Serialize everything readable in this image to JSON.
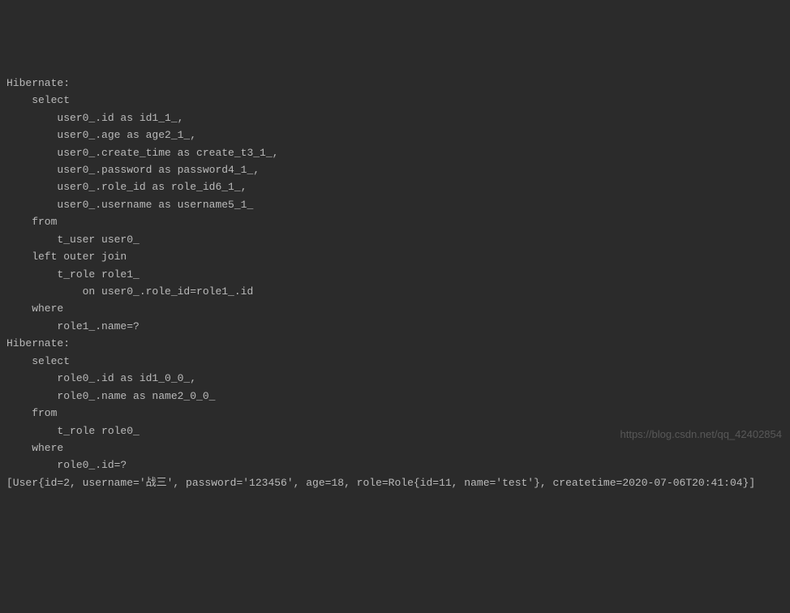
{
  "lines": [
    "Hibernate:",
    "    select",
    "        user0_.id as id1_1_,",
    "        user0_.age as age2_1_,",
    "        user0_.create_time as create_t3_1_,",
    "        user0_.password as password4_1_,",
    "        user0_.role_id as role_id6_1_,",
    "        user0_.username as username5_1_",
    "    from",
    "        t_user user0_",
    "    left outer join",
    "        t_role role1_",
    "            on user0_.role_id=role1_.id",
    "    where",
    "        role1_.name=?",
    "Hibernate:",
    "    select",
    "        role0_.id as id1_0_0_,",
    "        role0_.name as name2_0_0_",
    "    from",
    "        t_role role0_",
    "    where",
    "        role0_.id=?",
    "[User{id=2, username='战三', password='123456', age=18, role=Role{id=11, name='test'}, createtime=2020-07-06T20:41:04}]"
  ],
  "watermark": "https://blog.csdn.net/qq_42402854"
}
